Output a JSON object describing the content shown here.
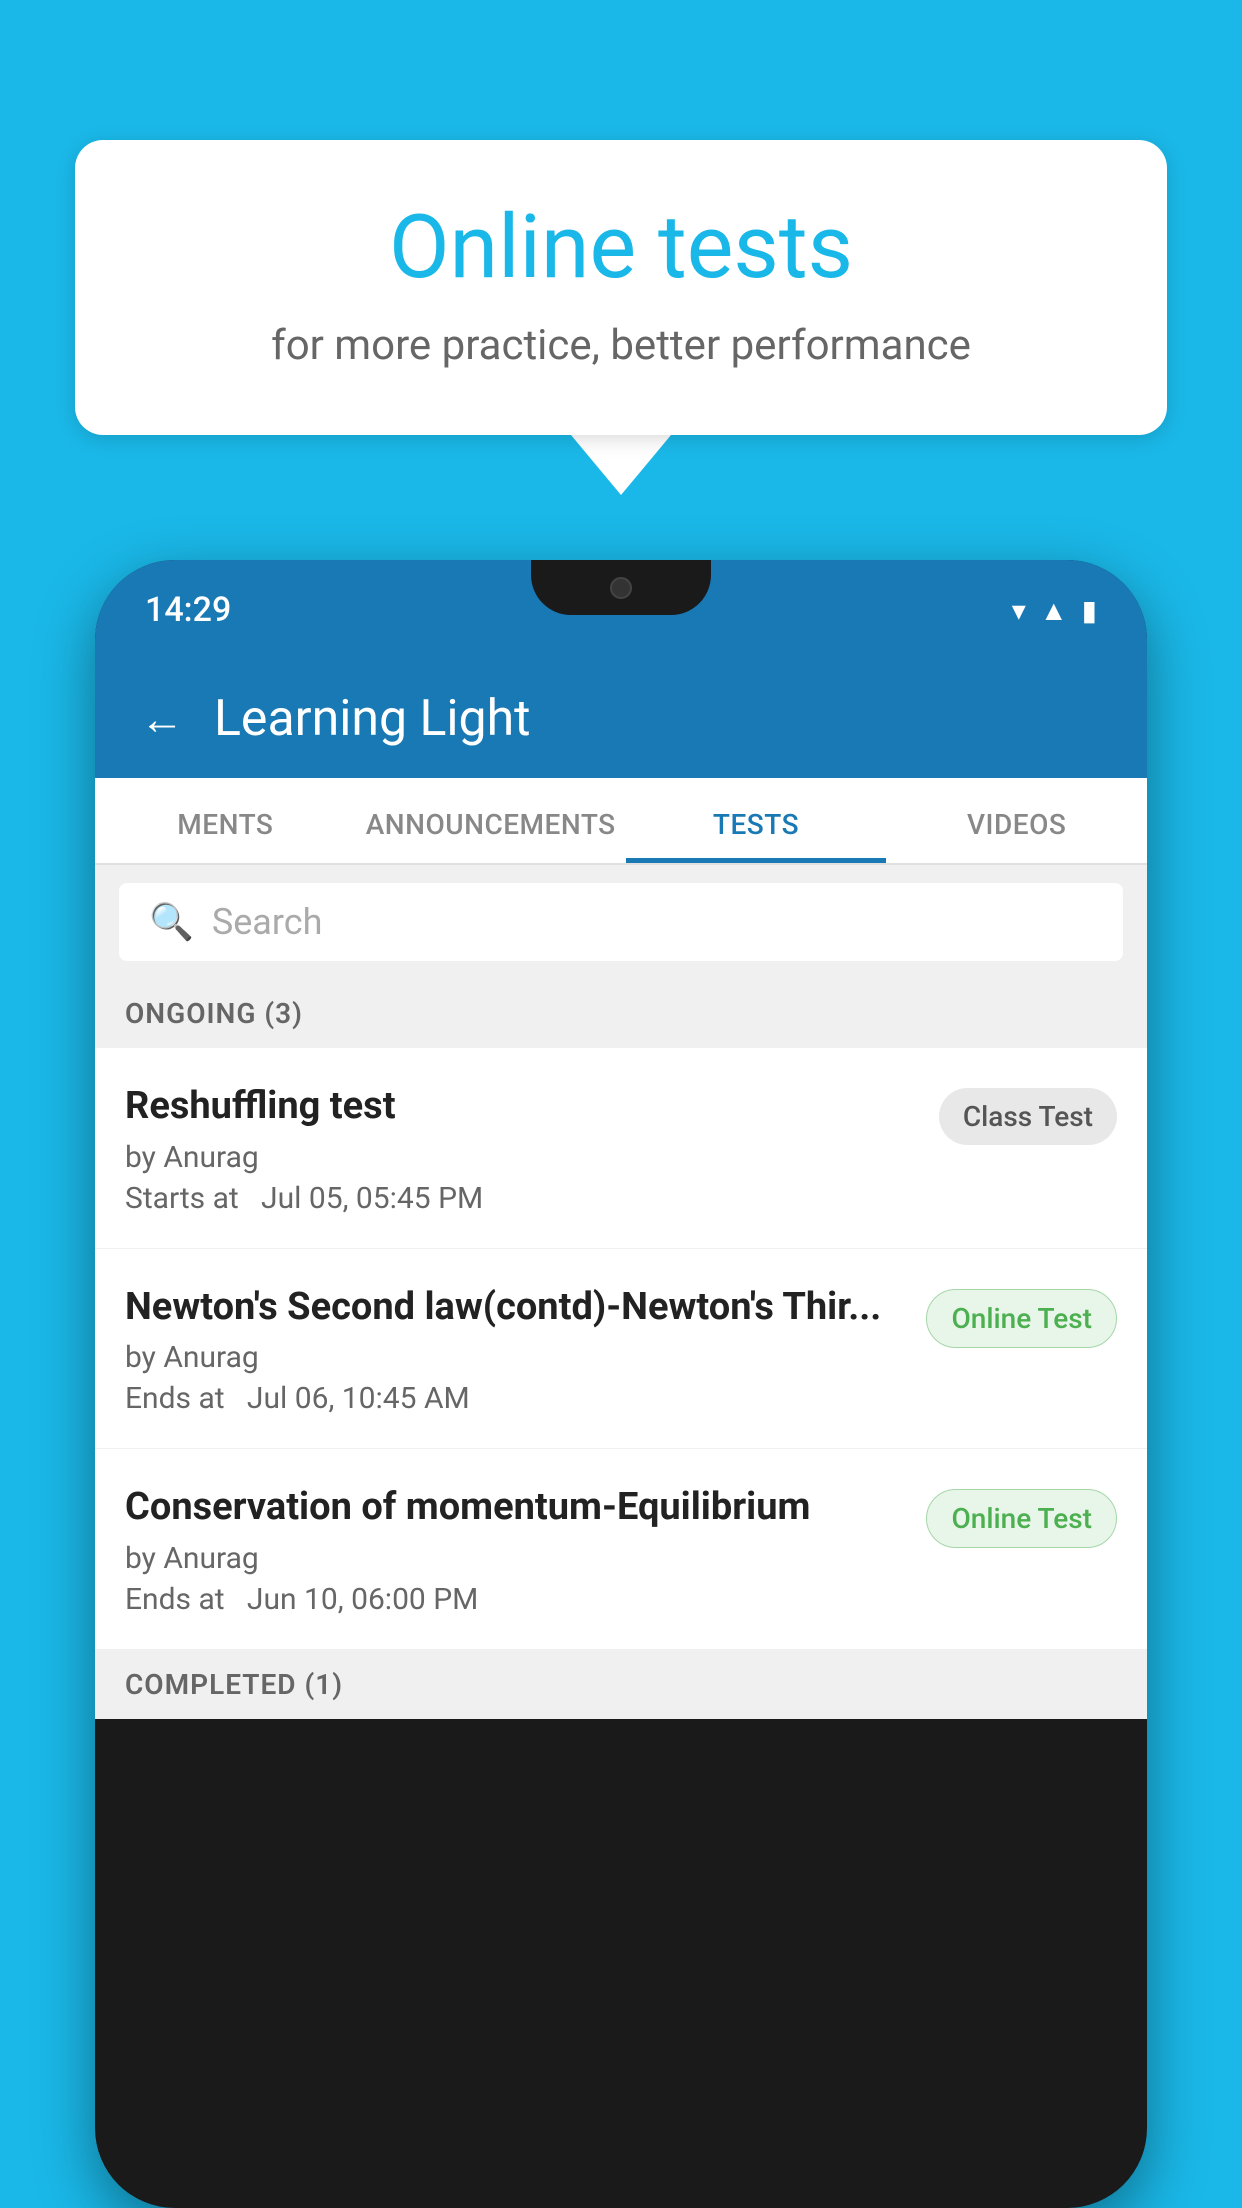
{
  "background_color": "#1ab8e8",
  "speech_bubble": {
    "title": "Online tests",
    "subtitle": "for more practice, better performance"
  },
  "phone": {
    "status_bar": {
      "time": "14:29"
    },
    "app_header": {
      "title": "Learning Light"
    },
    "tabs": [
      {
        "label": "MENTS",
        "active": false
      },
      {
        "label": "ANNOUNCEMENTS",
        "active": false
      },
      {
        "label": "TESTS",
        "active": true
      },
      {
        "label": "VIDEOS",
        "active": false
      }
    ],
    "search": {
      "placeholder": "Search"
    },
    "sections": [
      {
        "label": "ONGOING (3)",
        "items": [
          {
            "name": "Reshuffling test",
            "by": "by Anurag",
            "time": "Starts at  Jul 05, 05:45 PM",
            "badge": "Class Test",
            "badge_type": "class"
          },
          {
            "name": "Newton's Second law(contd)-Newton's Thir...",
            "by": "by Anurag",
            "time": "Ends at  Jul 06, 10:45 AM",
            "badge": "Online Test",
            "badge_type": "online"
          },
          {
            "name": "Conservation of momentum-Equilibrium",
            "by": "by Anurag",
            "time": "Ends at  Jun 10, 06:00 PM",
            "badge": "Online Test",
            "badge_type": "online"
          }
        ]
      }
    ],
    "completed_label": "COMPLETED (1)"
  }
}
